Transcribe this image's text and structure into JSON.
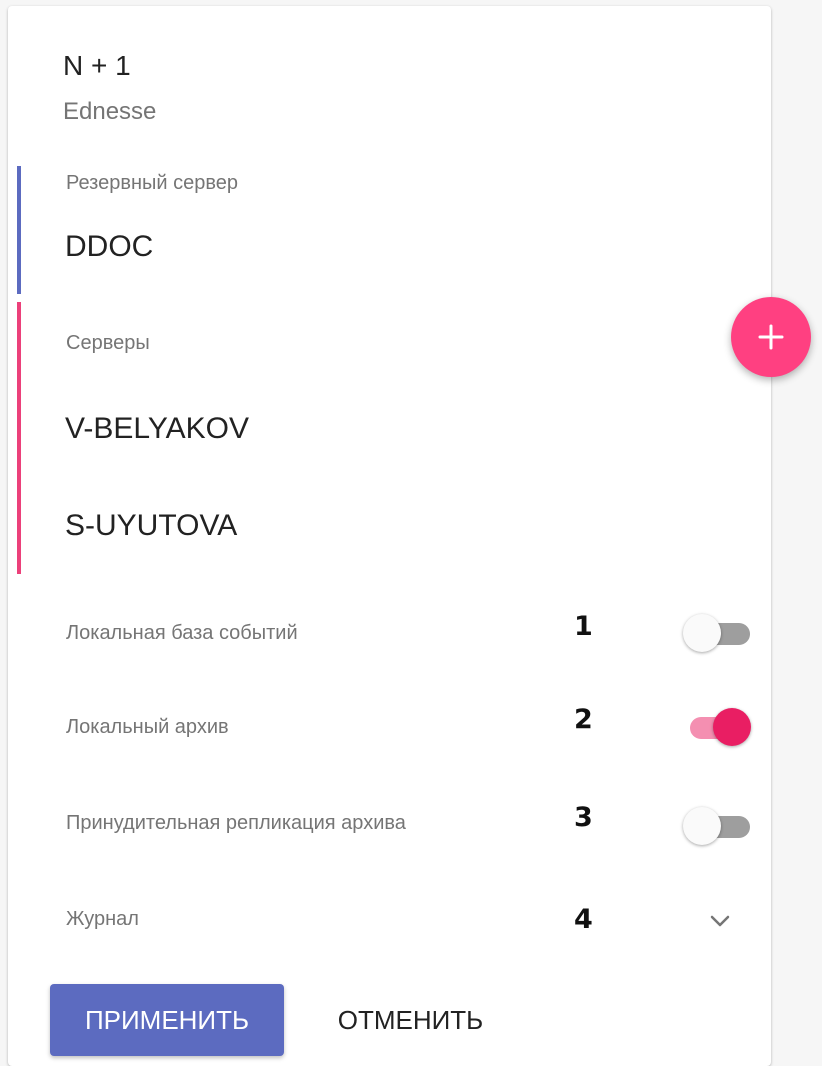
{
  "header": {
    "title": "N + 1",
    "subtitle": "Ednesse"
  },
  "backup_server": {
    "label": "Резервный сервер",
    "name": "DDOC",
    "accent_color": "#5c6bc0"
  },
  "servers": {
    "label": "Серверы",
    "items": [
      "V-BELYAKOV",
      "S-UYUTOVA"
    ],
    "accent_color": "#ec407a",
    "add_icon": "plus-icon",
    "add_button_color": "#ff4081"
  },
  "settings": [
    {
      "label": "Локальная база событий",
      "marker": "1",
      "checked": false
    },
    {
      "label": "Локальный архив",
      "marker": "2",
      "checked": true
    },
    {
      "label": "Принудительная репликация архива",
      "marker": "3",
      "checked": false
    }
  ],
  "journal": {
    "label": "Журнал",
    "marker": "4",
    "icon": "chevron-down-icon"
  },
  "actions": {
    "apply_label": "ПРИМЕНИТЬ",
    "cancel_label": "ОТМЕНИТЬ",
    "apply_color": "#5c6bc0"
  }
}
